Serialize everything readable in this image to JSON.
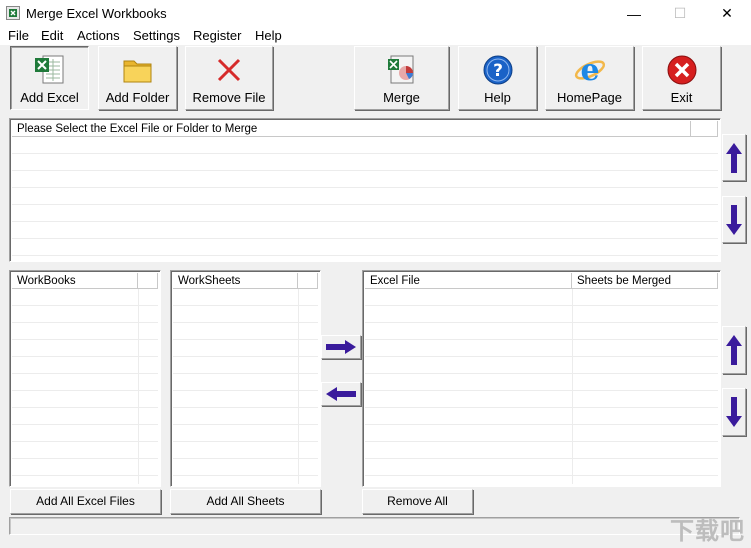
{
  "window": {
    "title": "Merge Excel Workbooks",
    "minimize": "—",
    "maximize": "☐",
    "close": "✕"
  },
  "menu": [
    "File",
    "Edit",
    "Actions",
    "Settings",
    "Register",
    "Help"
  ],
  "toolbar": {
    "add_excel": "Add Excel",
    "add_folder": "Add Folder",
    "remove_file": "Remove File",
    "merge": "Merge",
    "help": "Help",
    "homepage": "HomePage",
    "exit": "Exit"
  },
  "file_list": {
    "header": "Please Select the Excel File or Folder to Merge"
  },
  "workbooks": {
    "header": "WorkBooks"
  },
  "worksheets": {
    "header": "WorkSheets"
  },
  "merge_list": {
    "col_file": "Excel File",
    "col_sheets": "Sheets be Merged"
  },
  "buttons": {
    "add_all_excel": "Add All Excel Files",
    "add_all_sheets": "Add All Sheets",
    "remove_all": "Remove All"
  },
  "watermark": "下载吧",
  "colors": {
    "arrow": "#3a1b9c",
    "excel_green": "#1f7a3a",
    "folder": "#f5c842",
    "remove": "#d62b2b",
    "help": "#1a62c7",
    "exit": "#d61f1f"
  }
}
